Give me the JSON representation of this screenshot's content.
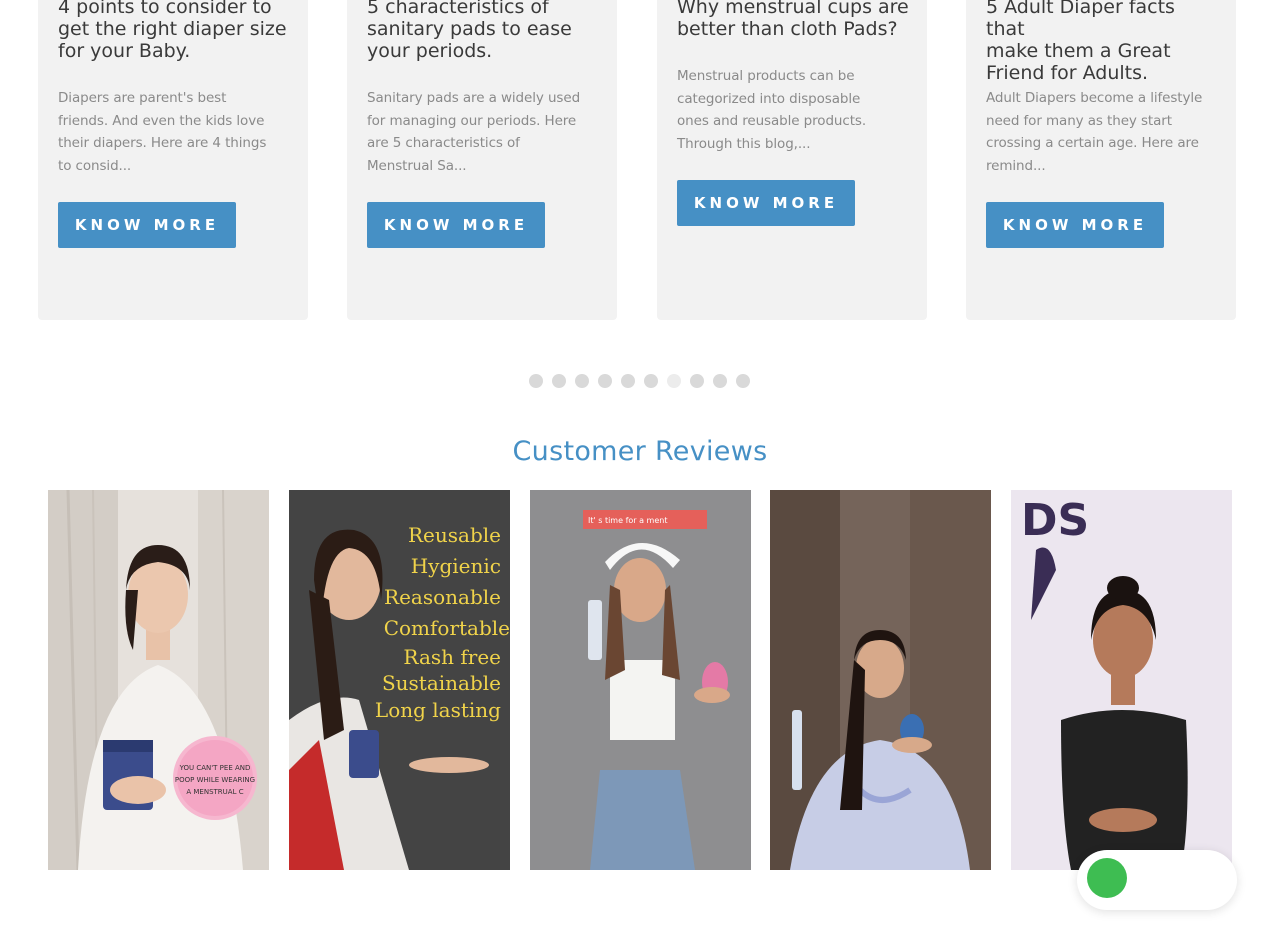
{
  "blog_cards": [
    {
      "title_lines": [
        "4 points to consider to",
        "get the right diaper size",
        "for your Baby."
      ],
      "excerpt_lines": [
        "Diapers are parent's best",
        "friends. And even the kids love",
        "their diapers. Here are 4 things",
        "to consid..."
      ],
      "button": "KNOW MORE"
    },
    {
      "title_lines": [
        "5 characteristics of",
        "sanitary pads to ease",
        "your periods."
      ],
      "excerpt_lines": [
        "Sanitary pads are a widely used",
        "for managing our periods. Here",
        "are 5 characteristics of",
        "Menstrual Sa..."
      ],
      "button": "KNOW MORE"
    },
    {
      "title_lines": [
        "Why menstrual cups are",
        "better than cloth Pads?"
      ],
      "excerpt_lines": [
        "Menstrual products can be",
        "categorized into disposable",
        "ones and reusable products.",
        "Through this blog,..."
      ],
      "button": "KNOW MORE"
    },
    {
      "title_lines": [
        "5 Adult Diaper facts that",
        "make them a Great",
        "Friend for Adults."
      ],
      "excerpt_lines": [
        "Adult Diapers become a lifestyle",
        "need for many as they start",
        "crossing a certain age. Here are",
        "remind..."
      ],
      "button": "KNOW MORE"
    }
  ],
  "carousel": {
    "dot_count": 10,
    "active_index": 6
  },
  "reviews": {
    "title": "Customer Reviews",
    "video1_sticker": [
      "YOU CAN'T  PEE AND",
      "POOP WHILE WEARING",
      "A MENSTRUAL C"
    ],
    "video2_words": [
      "Reusable",
      "Hygienic",
      "Reasonable",
      "Comfortable",
      "Rash free",
      "Sustainable",
      "Long lasting"
    ],
    "video3_caption": "It' s time for a ment",
    "video5_banner": "DS"
  },
  "colors": {
    "accent": "#4690c5",
    "card_bg": "#f2f2f2",
    "whatsapp": "#3ebd52"
  }
}
